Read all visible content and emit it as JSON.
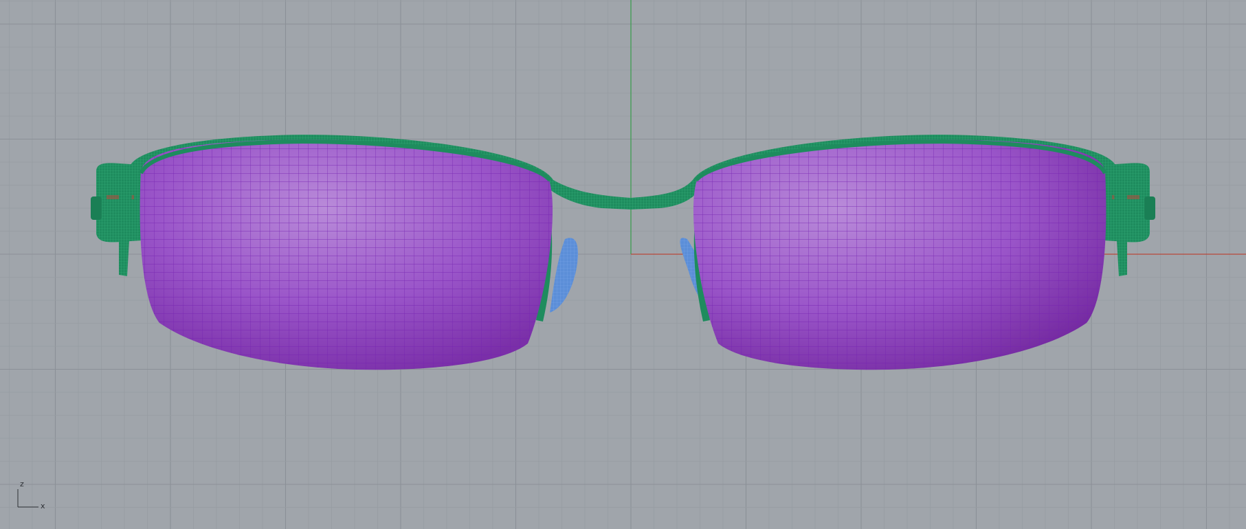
{
  "viewport": {
    "view": "Front",
    "axis_labels": {
      "vertical": "z",
      "horizontal": "x"
    },
    "colors": {
      "background": "#a0a5ab",
      "grid_minor": "#979ca2",
      "grid_major": "#8b9097",
      "axis_x": "#b8473a",
      "axis_z": "#3f9e52",
      "frame": "#1e8c5e",
      "frame_mesh": "#37b57c",
      "lens_light": "#b486d6",
      "lens_mid": "#9a55c9",
      "lens_dark": "#7a2fa8",
      "lens_mesh": "#7522b0",
      "nose_pad": "#5b8ed8"
    }
  },
  "model": {
    "parts": [
      "frame",
      "left-lens",
      "right-lens",
      "bridge",
      "left-nose-pad",
      "right-nose-pad",
      "left-hinge",
      "right-hinge"
    ]
  }
}
